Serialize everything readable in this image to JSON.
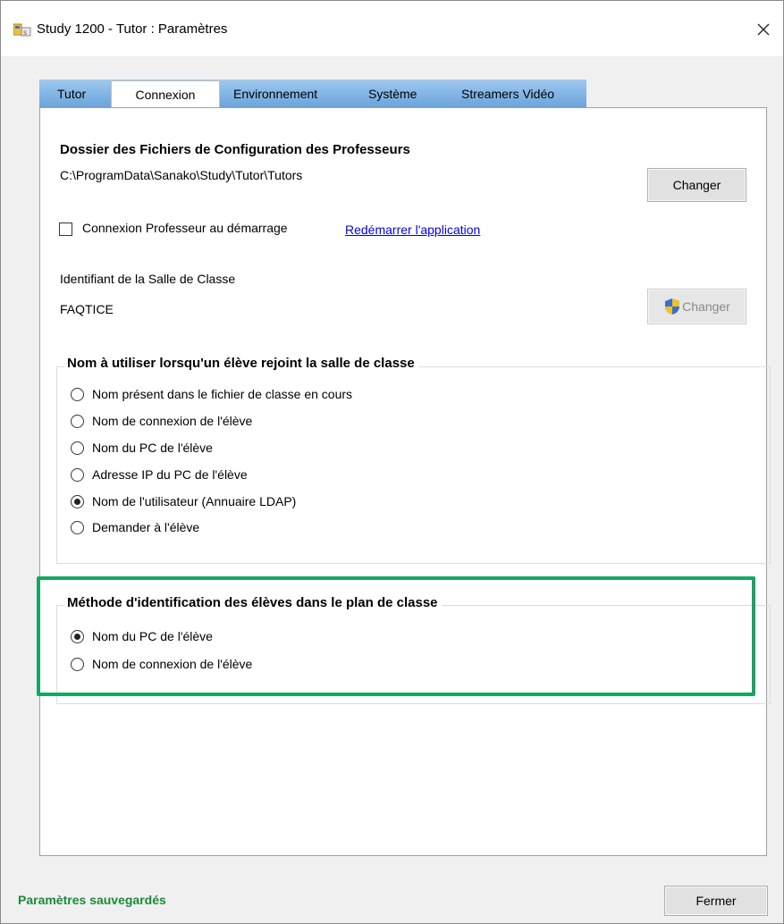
{
  "window": {
    "title": "Study 1200 - Tutor : Paramètres",
    "close_label": "×"
  },
  "tabs": [
    {
      "label": "Tutor",
      "active": false
    },
    {
      "label": "Connexion",
      "active": true
    },
    {
      "label": "Environnement",
      "active": false
    },
    {
      "label": "Système",
      "active": false
    },
    {
      "label": "Streamers Vidéo",
      "active": false
    }
  ],
  "config_folder": {
    "title": "Dossier des Fichiers de Configuration des Professeurs",
    "path": "C:\\ProgramData\\Sanako\\Study\\Tutor\\Tutors",
    "change_label": "Changer"
  },
  "teacher_login": {
    "label": "Connexion Professeur au démarrage",
    "checked": false,
    "restart_link": "Redémarrer l'application"
  },
  "classroom": {
    "label": "Identifiant de la Salle de Classe",
    "value": "FAQTICE",
    "change_label": "Changer",
    "change_enabled": false
  },
  "student_name_group": {
    "title": "Nom à utiliser lorsqu'un élève rejoint la salle de classe",
    "options": [
      {
        "label": "Nom présent dans le fichier de classe en cours",
        "checked": false
      },
      {
        "label": "Nom de connexion de l'élève",
        "checked": false
      },
      {
        "label": "Nom du PC de l'élève",
        "checked": false
      },
      {
        "label": "Adresse IP du PC de l'élève",
        "checked": false
      },
      {
        "label": "Nom de l'utilisateur (Annuaire LDAP)",
        "checked": true
      },
      {
        "label": "Demander à l'élève",
        "checked": false
      }
    ]
  },
  "identification_group": {
    "title": "Méthode d'identification des élèves dans le plan de classe",
    "options": [
      {
        "label": "Nom du PC de l'élève",
        "checked": true
      },
      {
        "label": "Nom de connexion de l'élève",
        "checked": false
      }
    ]
  },
  "footer": {
    "status": "Paramètres sauvegardés",
    "status_color": "#1a8a3a",
    "close_label": "Fermer"
  },
  "colors": {
    "highlight": "#19a463",
    "tabstrip": "#7fb4e6",
    "link": "#0000ee"
  }
}
